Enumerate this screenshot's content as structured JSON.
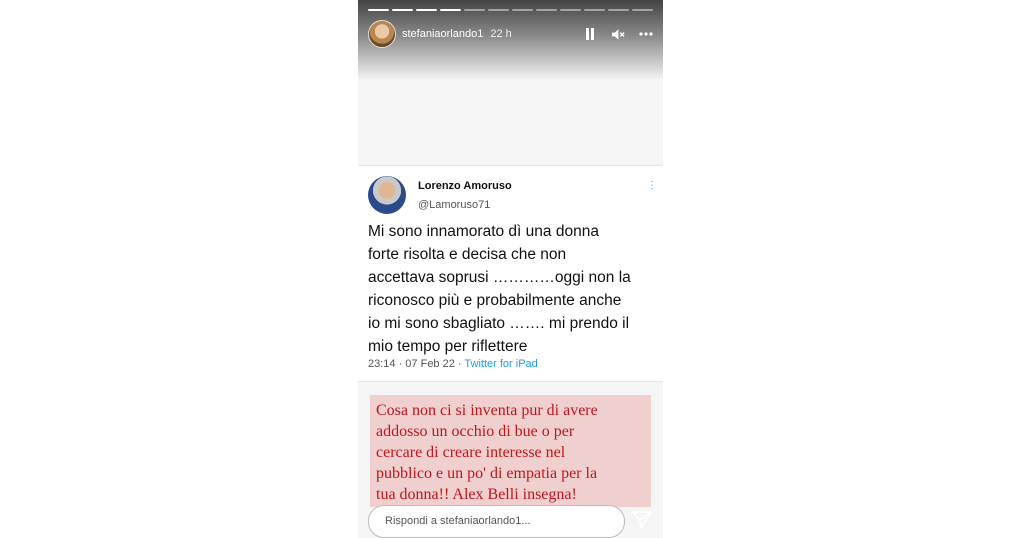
{
  "story": {
    "progress": {
      "total_segments": 12,
      "completed_segments": 4
    },
    "header": {
      "username": "stefaniaorlando1",
      "time": "22 h",
      "icons": [
        "pause-icon",
        "mute-icon",
        "more-icon"
      ]
    },
    "tweet": {
      "author_name": "Lorenzo Amoruso",
      "author_handle": "@Lamoruso71",
      "text_lines": [
        "Mi sono innamorato dì una donna",
        "forte risolta e decisa che non",
        "accettava soprusi …………oggi non la",
        "riconosco più e probabilmente anche",
        "io mi sono sbagliato ……. mi prendo il",
        "mio tempo per riflettere"
      ],
      "timestamp": "23:14 · 07 Feb 22 · ",
      "source": "Twitter for iPad"
    },
    "overlay_text": {
      "lines": [
        "Cosa non ci si inventa pur di avere",
        "addosso un occhio di bue o per",
        "cercare di creare interesse nel",
        "pubblico e un po' di empatia per la",
        "tua donna!! Alex Belli insegna!"
      ],
      "color": "#c0161a",
      "background": "#f0cfcf"
    },
    "reply": {
      "placeholder": "Rispondi a stefaniaorlando1..."
    }
  }
}
